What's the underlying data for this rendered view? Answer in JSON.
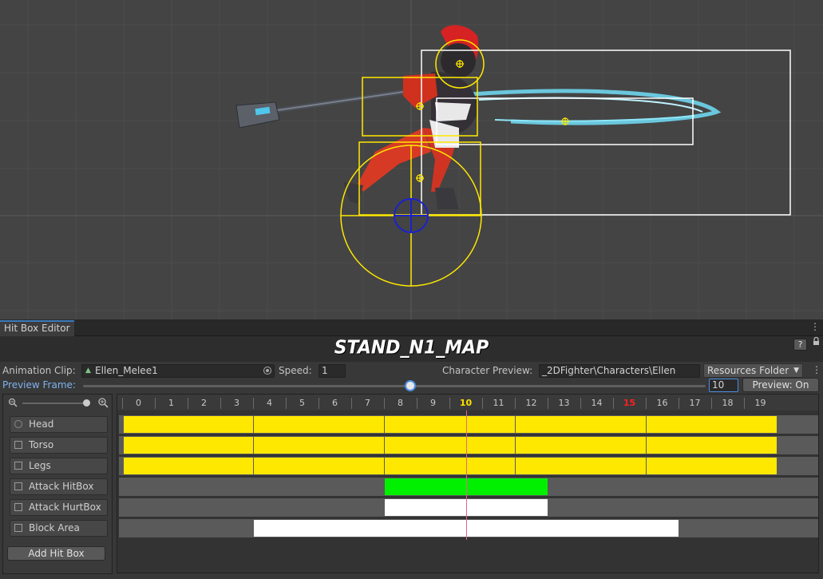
{
  "window": {
    "tab_label": "Hit Box Editor",
    "title": "STAND_N1_MAP"
  },
  "clip": {
    "label": "Animation Clip:",
    "value": "Ellen_Melee1"
  },
  "speed": {
    "label": "Speed:",
    "value": "1"
  },
  "character_preview": {
    "label": "Character Preview:",
    "value": "_2DFighter\\Characters\\Ellen"
  },
  "resources": {
    "value": "Resources Folder"
  },
  "preview": {
    "frame_label": "Preview Frame:",
    "frame_value": "10",
    "toggle_label": "Preview: On",
    "slider_fraction": 0.5
  },
  "help": {
    "label": "?"
  },
  "layers": [
    {
      "label": "Head"
    },
    {
      "label": "Torso"
    },
    {
      "label": "Legs"
    },
    {
      "label": "Attack HitBox"
    },
    {
      "label": "Attack HurtBox"
    },
    {
      "label": "Block Area"
    }
  ],
  "add_button": {
    "label": "Add Hit Box"
  },
  "timeline": {
    "frames": [
      "0",
      "1",
      "2",
      "3",
      "4",
      "5",
      "6",
      "7",
      "8",
      "9",
      "10",
      "11",
      "12",
      "13",
      "14",
      "15",
      "16",
      "17",
      "18",
      "19"
    ],
    "current_frame": 10,
    "marked_frame": 15,
    "tracks": [
      {
        "name": "Head",
        "segments": [
          [
            0,
            4
          ],
          [
            4,
            8
          ],
          [
            8,
            12
          ],
          [
            12,
            16
          ],
          [
            16,
            20
          ]
        ],
        "color": "#ffe800"
      },
      {
        "name": "Torso",
        "segments": [
          [
            0,
            4
          ],
          [
            4,
            8
          ],
          [
            8,
            12
          ],
          [
            12,
            16
          ],
          [
            16,
            20
          ]
        ],
        "color": "#ffe800"
      },
      {
        "name": "Legs",
        "segments": [
          [
            0,
            4
          ],
          [
            4,
            8
          ],
          [
            8,
            12
          ],
          [
            12,
            16
          ],
          [
            16,
            20
          ]
        ],
        "color": "#ffe800"
      },
      {
        "name": "Attack HitBox",
        "segments": [
          [
            8,
            13
          ]
        ],
        "color": "#00f000"
      },
      {
        "name": "Attack HurtBox",
        "segments": [
          [
            8,
            13
          ]
        ],
        "color": "#ffffff"
      },
      {
        "name": "Block Area",
        "segments": [
          [
            4,
            17
          ]
        ],
        "color": "#ffffff"
      }
    ]
  },
  "colors": {
    "accent": "#3a79bb",
    "current_frame": "#ffe000",
    "marked_frame": "#ff2020",
    "cursor": "#e06a84"
  },
  "icons": [
    "kebab-menu-icon",
    "lock-icon",
    "object-picker-icon",
    "zoom-out-icon",
    "zoom-in-icon",
    "dropdown-arrow-icon",
    "animation-clip-icon"
  ]
}
